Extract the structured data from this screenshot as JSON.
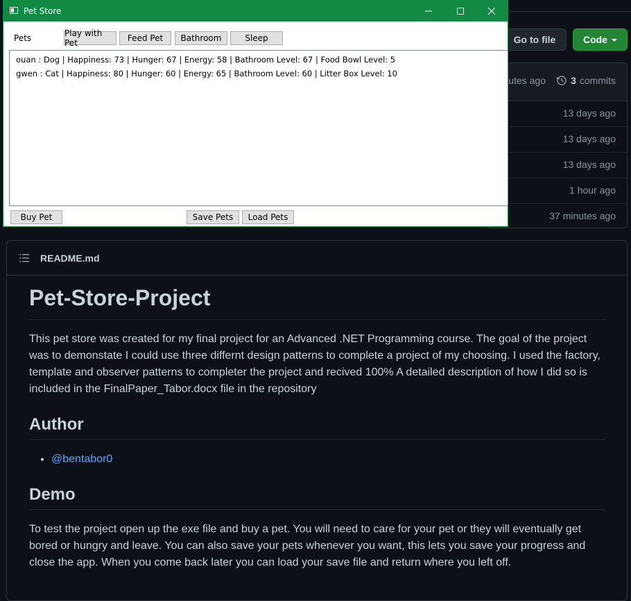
{
  "github": {
    "goto_file_label": "Go to file",
    "code_label": "Code",
    "header_time": "utes ago",
    "commits_count": "3",
    "commits_label": "commits",
    "file_times": [
      "13 days ago",
      "13 days ago",
      "13 days ago",
      "1 hour ago",
      "37 minutes ago"
    ],
    "readme": {
      "filename": "README.md",
      "title": "Pet-Store-Project",
      "intro": "This pet store was created for my final project for an Advanced .NET Programming course. The goal of the project was to demonstate I could use three differnt design patterns to complete a project of my choosing. I used the factory, template and observer patterns to completer the project and recived 100% A detailed description of how I did so is included in the FinalPaper_Tabor.docx file in the repository",
      "author_heading": "Author",
      "author_link": "@bentabor0",
      "demo_heading": "Demo",
      "demo_text": "To test the project open up the exe file and buy a pet. You will need to care for your pet or they will eventually get bored or hungry and leave. You can also save your pets whenever you want, this lets you save your progress and close the app. When you come back later you can load your save file and return where you left off."
    },
    "colors": {
      "background": "#0d1117",
      "code_button": "#238636",
      "link": "#58a6ff"
    }
  },
  "window": {
    "title": "Pet Store",
    "pets_label": "Pets",
    "buttons": {
      "play": "Play with Pet",
      "feed": "Feed Pet",
      "bathroom": "Bathroom",
      "sleep": "Sleep",
      "buy": "Buy Pet",
      "save": "Save Pets",
      "load": "Load Pets"
    },
    "pets": [
      "ouan : Dog | Happiness: 73 | Hunger: 67 | Energy: 58 | Bathroom Level: 67 | Food Bowl Level: 5",
      "gwen : Cat | Happiness: 80 | Hunger: 60 | Energy: 65 | Bathroom Level: 60 | Litter Box Level: 10"
    ],
    "colors": {
      "titlebar": "#138a43"
    }
  }
}
